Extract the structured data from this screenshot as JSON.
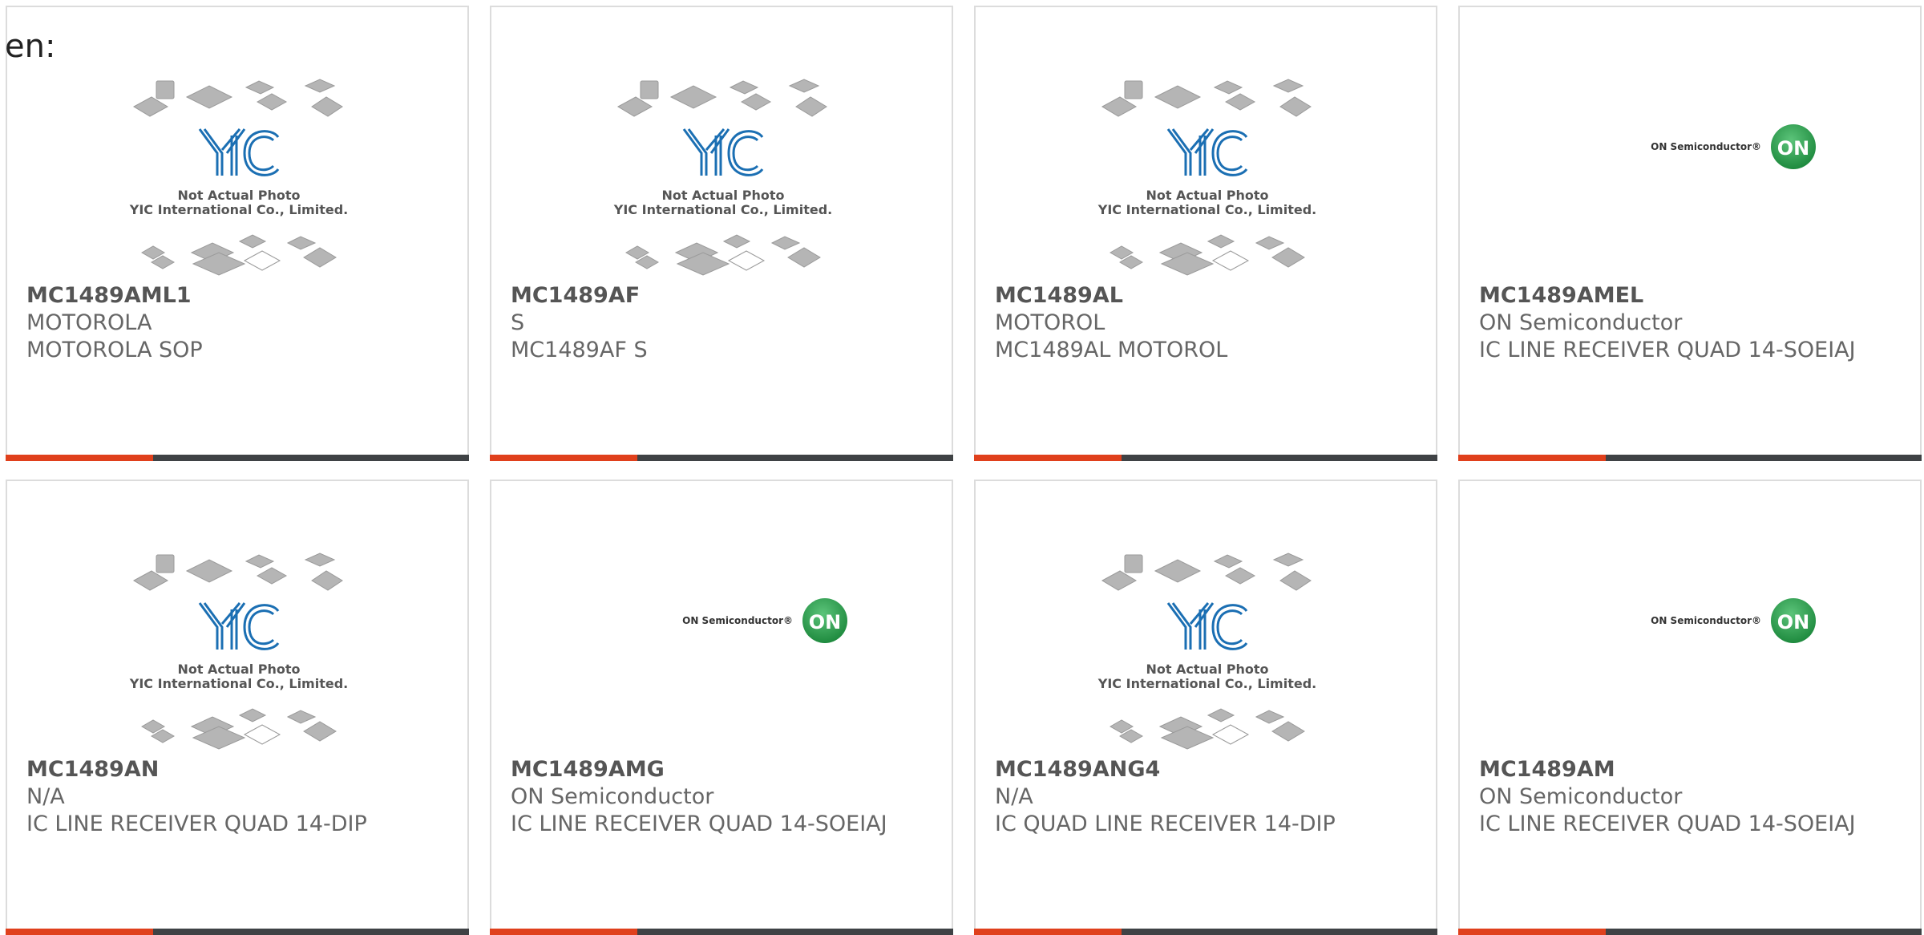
{
  "language_label": "en:",
  "colors": {
    "accent": "#e0401c",
    "bar": "#3f4245",
    "yic_blue": "#1b6fb3",
    "on_green": "#1e8a3e"
  },
  "cards": [
    {
      "part": "MC1489AML1",
      "brand": "MOTOROLA",
      "desc": "MOTOROLA SOP",
      "image": "yic-placeholder",
      "photo_caption_1": "Not Actual Photo",
      "photo_caption_2": "YIC International Co., Limited."
    },
    {
      "part": "MC1489AF",
      "brand": "S",
      "desc": "MC1489AF S",
      "image": "yic-placeholder",
      "photo_caption_1": "Not Actual Photo",
      "photo_caption_2": "YIC International Co., Limited."
    },
    {
      "part": "MC1489AL",
      "brand": "MOTOROL",
      "desc": "MC1489AL MOTOROL",
      "image": "yic-placeholder",
      "photo_caption_1": "Not Actual Photo",
      "photo_caption_2": "YIC International Co., Limited."
    },
    {
      "part": "MC1489AMEL",
      "brand": "ON Semiconductor",
      "desc": "IC LINE RECEIVER QUAD 14-SOEIAJ",
      "image": "on-semi-logo",
      "logo_text": "ON Semiconductor®",
      "logo_mark": "ON"
    },
    {
      "part": "MC1489AN",
      "brand": "N/A",
      "desc": "IC LINE RECEIVER QUAD 14-DIP",
      "image": "yic-placeholder",
      "photo_caption_1": "Not Actual Photo",
      "photo_caption_2": "YIC International Co., Limited."
    },
    {
      "part": "MC1489AMG",
      "brand": "ON Semiconductor",
      "desc": "IC LINE RECEIVER QUAD 14-SOEIAJ",
      "image": "on-semi-logo",
      "logo_text": "ON Semiconductor®",
      "logo_mark": "ON"
    },
    {
      "part": "MC1489ANG4",
      "brand": "N/A",
      "desc": "IC QUAD LINE RECEIVER 14-DIP",
      "image": "yic-placeholder",
      "photo_caption_1": "Not Actual Photo",
      "photo_caption_2": "YIC International Co., Limited."
    },
    {
      "part": "MC1489AM",
      "brand": "ON Semiconductor",
      "desc": "IC LINE RECEIVER QUAD 14-SOEIAJ",
      "image": "on-semi-logo",
      "logo_text": "ON Semiconductor®",
      "logo_mark": "ON"
    }
  ]
}
